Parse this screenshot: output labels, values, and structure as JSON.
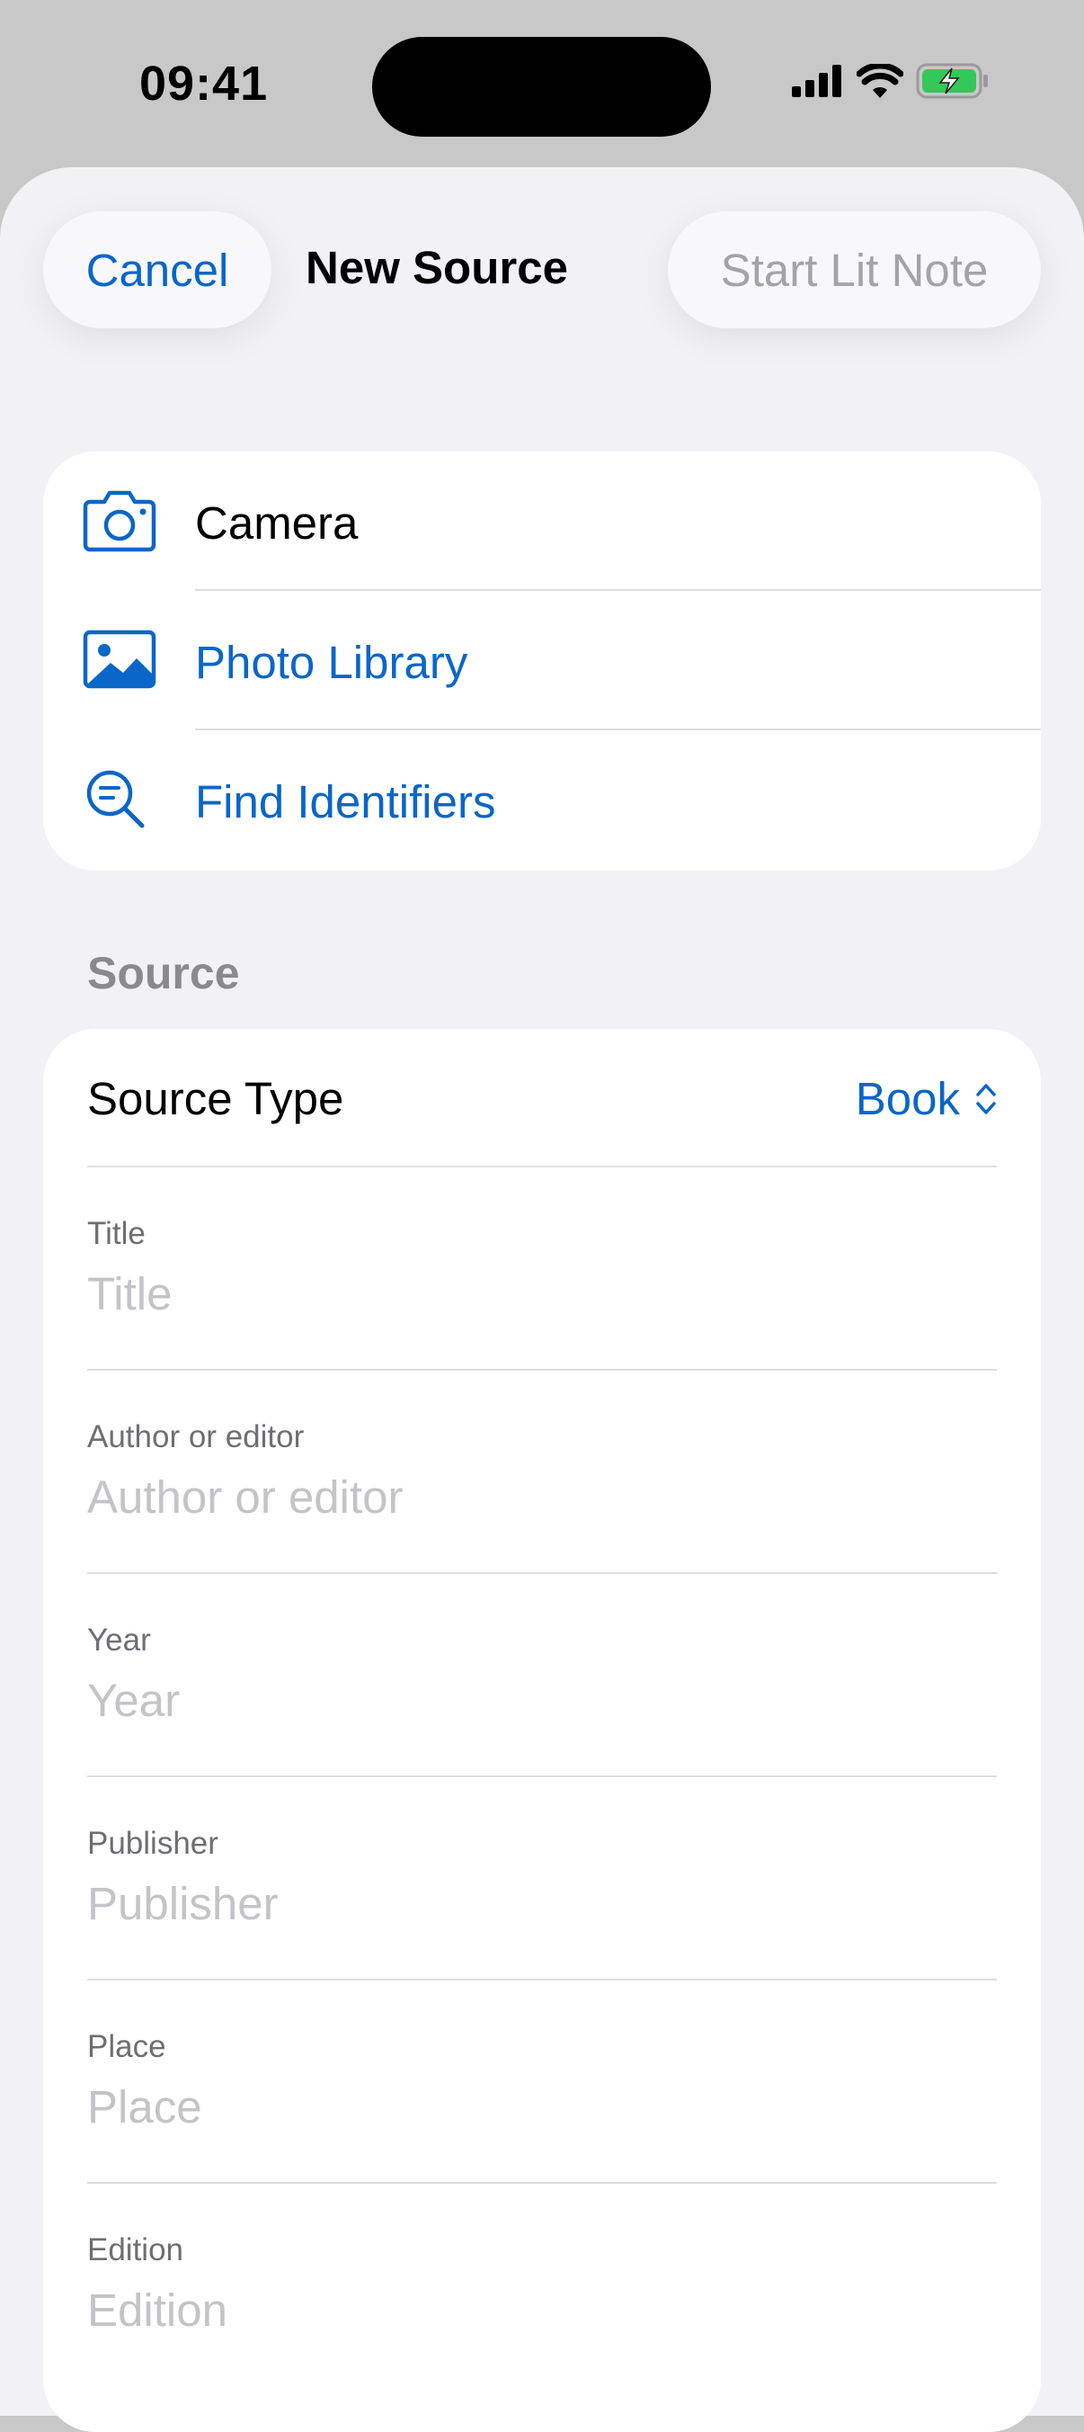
{
  "status_bar": {
    "time": "09:41",
    "icons": [
      "cellular-signal-icon",
      "wifi-icon",
      "battery-charging-icon"
    ]
  },
  "nav": {
    "cancel_label": "Cancel",
    "title": "New Source",
    "start_label": "Start Lit Note"
  },
  "actions": [
    {
      "label": "Camera",
      "icon": "camera-icon"
    },
    {
      "label": "Photo Library",
      "icon": "photo-icon"
    },
    {
      "label": "Find Identifiers",
      "icon": "magnifier-text-icon"
    }
  ],
  "section": {
    "title": "Source"
  },
  "source_type": {
    "label": "Source Type",
    "value": "Book"
  },
  "fields": [
    {
      "label": "Title",
      "placeholder": "Title"
    },
    {
      "label": "Author or editor",
      "placeholder": "Author or editor"
    },
    {
      "label": "Year",
      "placeholder": "Year"
    },
    {
      "label": "Publisher",
      "placeholder": "Publisher"
    },
    {
      "label": "Place",
      "placeholder": "Place"
    },
    {
      "label": "Edition",
      "placeholder": "Edition"
    }
  ],
  "colors": {
    "accent": "#0a66c8",
    "disabled": "#a3a3a8",
    "battery": "#34c759",
    "background": "#f1f1f6"
  }
}
